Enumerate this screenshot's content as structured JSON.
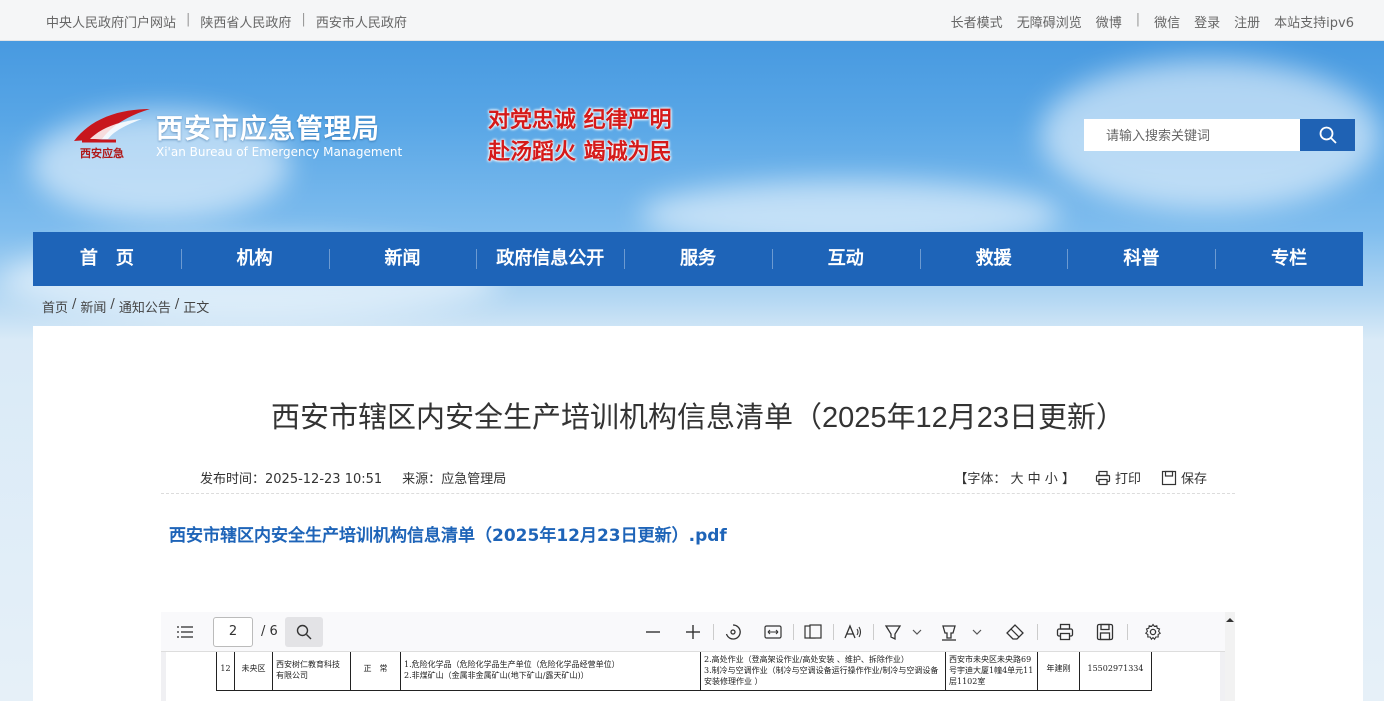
{
  "topbar": {
    "links_left": [
      "中央人民政府门户网站",
      "陕西省人民政府",
      "西安市人民政府"
    ],
    "links_right": [
      "长者模式",
      "无障碍浏览",
      "微博",
      "微信",
      "登录",
      "注册",
      "本站支持ipv6"
    ]
  },
  "header": {
    "logo_title": "西安市应急管理局",
    "logo_en": "Xi'an Bureau of Emergency Management",
    "logo_sub": "西安应急",
    "slogan_line1": "对党忠诚 纪律严明",
    "slogan_line2": "赴汤蹈火 竭诚为民",
    "search_placeholder": "请输入搜索关键词"
  },
  "nav": [
    "首　页",
    "机构",
    "新闻",
    "政府信息公开",
    "服务",
    "互动",
    "救援",
    "科普",
    "专栏"
  ],
  "breadcrumb": [
    "首页",
    "新闻",
    "通知公告",
    "正文"
  ],
  "article": {
    "title": "西安市辖区内安全生产培训机构信息清单（2025年12月23日更新）",
    "publish_label": "发布时间：",
    "publish_time": "2025-12-23 10:51",
    "source_label": "来源：",
    "source": "应急管理局",
    "font_size_label": "【字体：",
    "font_large": "大",
    "font_medium": "中",
    "font_small": "小",
    "font_close": "】",
    "print": "打印",
    "save": "保存",
    "attachment": "西安市辖区内安全生产培训机构信息清单（2025年12月23日更新）.pdf"
  },
  "pdf_viewer": {
    "current_page": "2",
    "total_pages": "/ 6",
    "row": {
      "no": "12",
      "district": "未央区",
      "name": "西安树仁教育科技有限公司",
      "type": "正　常",
      "scope1": "1.危险化学品（危险化学品生产单位（危险化学品经营单位）",
      "scope2": "2.非煤矿山（金属非金属矿山(地下矿山/露天矿山)）",
      "special1": "2.高处作业（登高架设作业/高处安装 、维护、拆除作业）",
      "special2": "3.制冷与空调作业（制冷与空调设备运行操作作业/制冷与空调设备安装修理作业 ）",
      "address": "西安市未央区未央路69号宇迪大厦1幢4单元11层1102室",
      "period": "年建刚",
      "phone": "15502971334"
    }
  },
  "colors": {
    "nav_bg": "#1e64b8",
    "search_btn": "#1f62b4",
    "slogan": "#d51a1a",
    "link": "#1e64b8"
  }
}
